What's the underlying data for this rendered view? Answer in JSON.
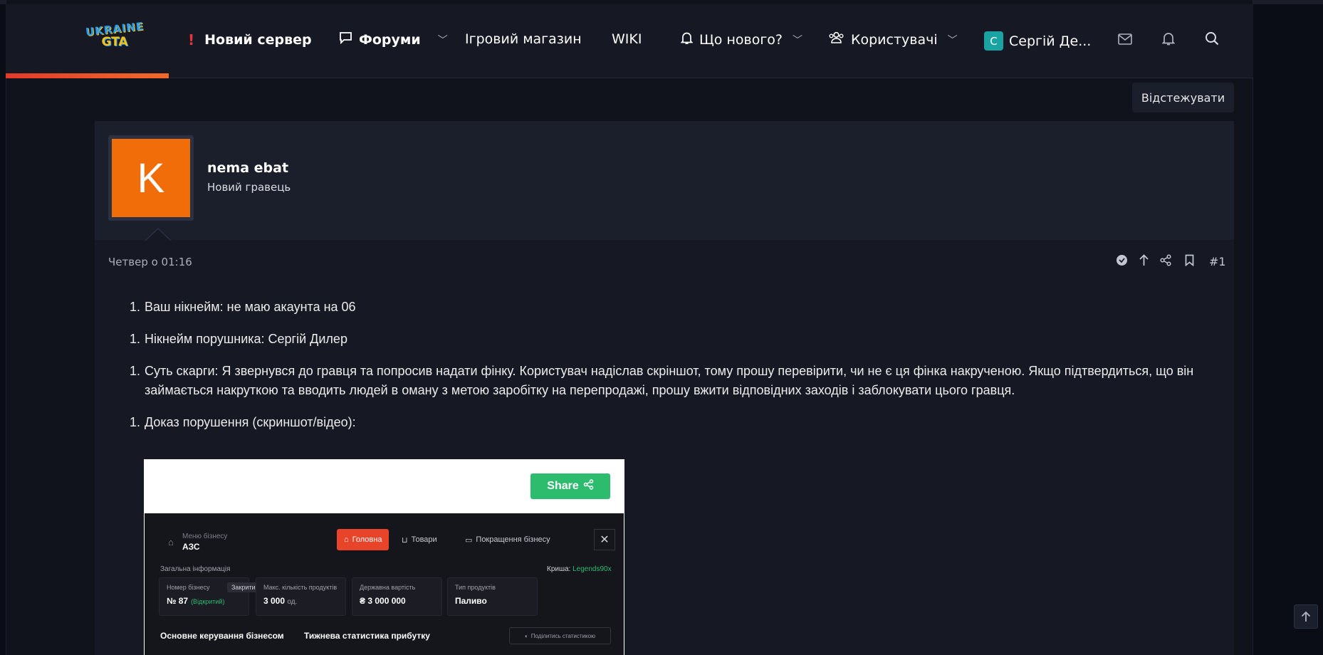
{
  "header": {
    "logo_top": "UKRAINE",
    "logo_bottom": "GTA",
    "nav": {
      "new_server": "Новий сервер",
      "forums": "Форуми",
      "shop": "Ігровий магазин",
      "wiki": "WIKI",
      "whats_new": "Що нового?",
      "users": "Користувачі",
      "account_initial": "С",
      "account_name": "Сергій Де..."
    }
  },
  "follow_label": "Відстежувати",
  "post": {
    "author": "nema ebat",
    "author_initial": "K",
    "author_title": "Новий гравець",
    "date": "Четвер о 01:16",
    "number": "#1",
    "items": [
      {
        "num": "1.",
        "text": "Ваш нікнейм: не маю акаунта на 06"
      },
      {
        "num": "1.",
        "text": "Нікнейм порушника: Сергій Дилер"
      },
      {
        "num": "1.",
        "text": "Суть скарги: Я звернувся до гравця та попросив надати фінку. Користувач надіслав скріншот, тому прошу перевірити, чи не є ця фінка накрученою. Якщо підтвердиться, що він займається накруткою та вводить людей в оману з метою заробітку на перепродажі, прошу вжити відповідних заходів і заблокувати цього гравця."
      },
      {
        "num": "1.",
        "text": "Доказ порушення (скриншот/відео):"
      }
    ]
  },
  "screenshot": {
    "share_label": "Share",
    "menu_label": "Меню бізнесу",
    "menu_name": "АЗС",
    "tabs": [
      "Головна",
      "Товари",
      "Покращення бізнесу"
    ],
    "section": "Загальна інформація",
    "roof_label": "Криша:",
    "roof_value": "Legends90x",
    "cards": [
      {
        "label": "Номер бізнесу",
        "value": "№ 87",
        "extra": "(Відкритий)",
        "button": "Закрити"
      },
      {
        "label": "Макс. кількість продуктів",
        "value": "3 000",
        "unit": "од."
      },
      {
        "label": "Державна вартість",
        "value": "₴ 3 000 000"
      },
      {
        "label": "Тип продуктів",
        "value": "Паливо"
      }
    ],
    "heading_left": "Основне керування бізнесом",
    "heading_mid": "Тижнева статистика прибутку",
    "share_stats": "Поділитись статистикою"
  },
  "colors": {
    "accent": "#e23a2a",
    "avatar": "#f06d0a",
    "share": "#2dbb6e"
  }
}
